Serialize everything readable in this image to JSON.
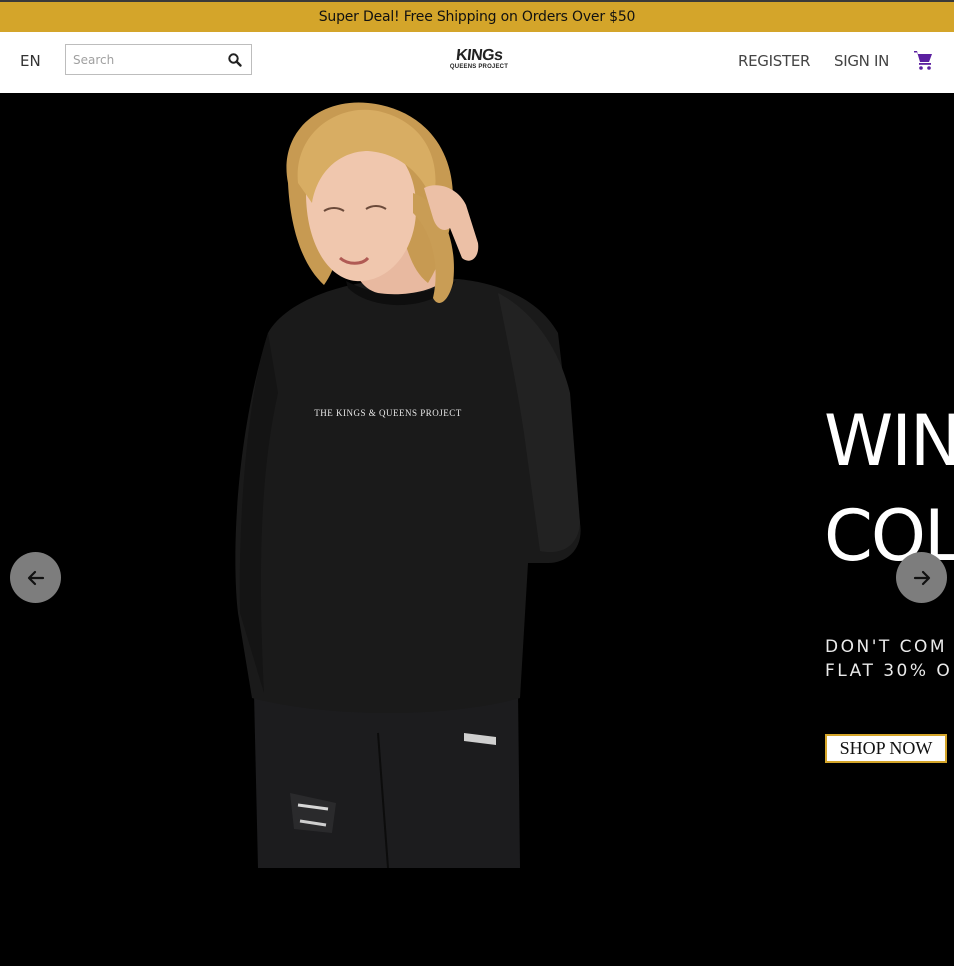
{
  "announcement": {
    "text": "Super Deal! Free Shipping on Orders Over $50"
  },
  "header": {
    "language": "EN",
    "search": {
      "placeholder": "Search",
      "value": ""
    },
    "logo": {
      "top": "KINGs",
      "bottom": "QUEENS PROJECT"
    },
    "register_label": "REGISTER",
    "signin_label": "SIGN IN",
    "cart_icon": "cart-icon"
  },
  "hero": {
    "sweater_print": "THE KINGS & QUEENS PROJECT",
    "title_line1": "WIN",
    "title_line2": "COL",
    "subtitle_line1": "DON'T COM",
    "subtitle_line2": "FLAT 30% O",
    "shop_label": "SHOP NOW",
    "prev_icon": "arrow-left-icon",
    "next_icon": "arrow-right-icon"
  },
  "colors": {
    "accent": "#d4a52a",
    "cart": "#5b1fa0",
    "background": "#000000",
    "header_bg": "#ffffff"
  }
}
